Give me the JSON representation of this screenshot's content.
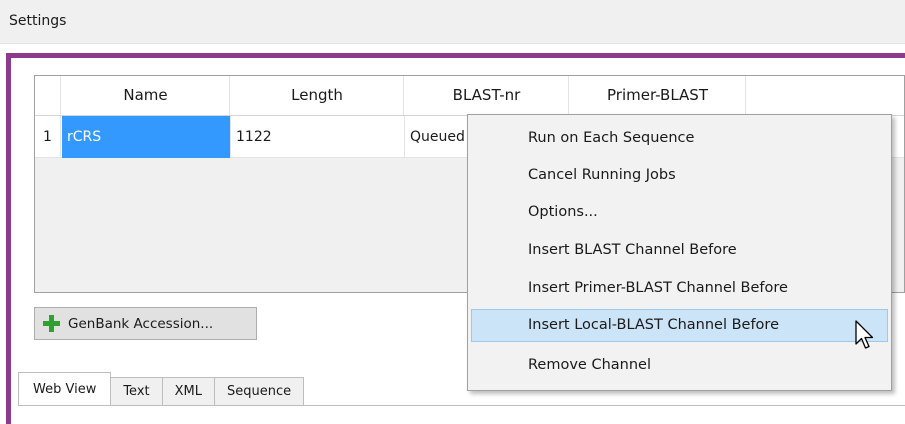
{
  "settings": {
    "label": "Settings"
  },
  "grid": {
    "columns": [
      "Name",
      "Length",
      "BLAST-nr",
      "Primer-BLAST"
    ],
    "rows": [
      {
        "number": "1",
        "name": "rCRS",
        "length": "1122",
        "blast_nr": "Queued"
      }
    ]
  },
  "buttons": {
    "genbank": "GenBank Accession..."
  },
  "tabs": [
    "Web View",
    "Text",
    "XML",
    "Sequence"
  ],
  "context_menu": {
    "items": [
      "Run on Each Sequence",
      "Cancel Running Jobs",
      "Options...",
      "Insert BLAST Channel Before",
      "Insert Primer-BLAST Channel Before",
      "Insert Local-BLAST Channel Before",
      "Remove Channel"
    ],
    "highlighted_index": 5
  },
  "colors": {
    "frame": "#8b3a8e",
    "selection": "#3399ff",
    "menu_highlight": "#cce4f7",
    "add_icon": "#2ea12e"
  },
  "icons": {
    "genbank_button": "plus-icon",
    "pointer": "arrow-cursor-icon"
  }
}
